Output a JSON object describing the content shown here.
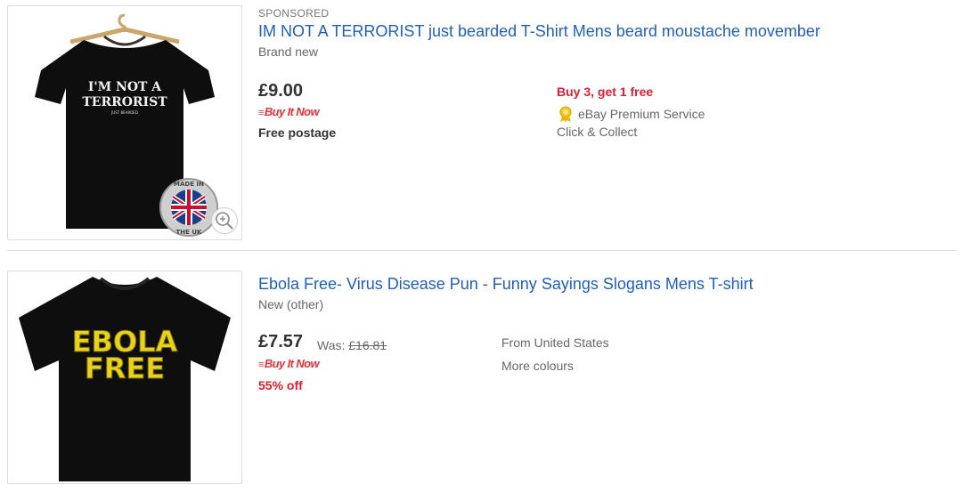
{
  "listings": [
    {
      "sponsored_label": "SPONSORED",
      "title": "IM NOT A TERRORIST just bearded T-Shirt Mens beard moustache movember",
      "condition": "Brand new",
      "price": "£9.00",
      "buy_it_now": "Buy It Now",
      "postage": "Free postage",
      "promo": "Buy 3, get 1 free",
      "premium_service": "eBay Premium Service",
      "collect": "Click & Collect",
      "image_text": {
        "line1": "I'M NOT A",
        "line2": "TERRORIST",
        "line3": "JUST BEARDED"
      },
      "badge_text": "MADE IN THE UK"
    },
    {
      "title": "Ebola Free- Virus Disease Pun - Funny Sayings Slogans Mens T-shirt",
      "condition": "New (other)",
      "price": "£7.57",
      "was_label": "Was:",
      "was_price": "£16.81",
      "buy_it_now": "Buy It Now",
      "discount": "55% off",
      "location": "From United States",
      "more_colours": "More colours",
      "image_text": {
        "line1": "EBOLA",
        "line2": "FREE"
      }
    }
  ],
  "colors": {
    "link": "#1f5fbf",
    "promo_red": "#dd1e31",
    "bin_red": "#e53238",
    "muted": "#666666"
  },
  "icons": [
    "zoom-icon",
    "medal-icon",
    "made-in-uk-badge",
    "union-jack-flag"
  ]
}
